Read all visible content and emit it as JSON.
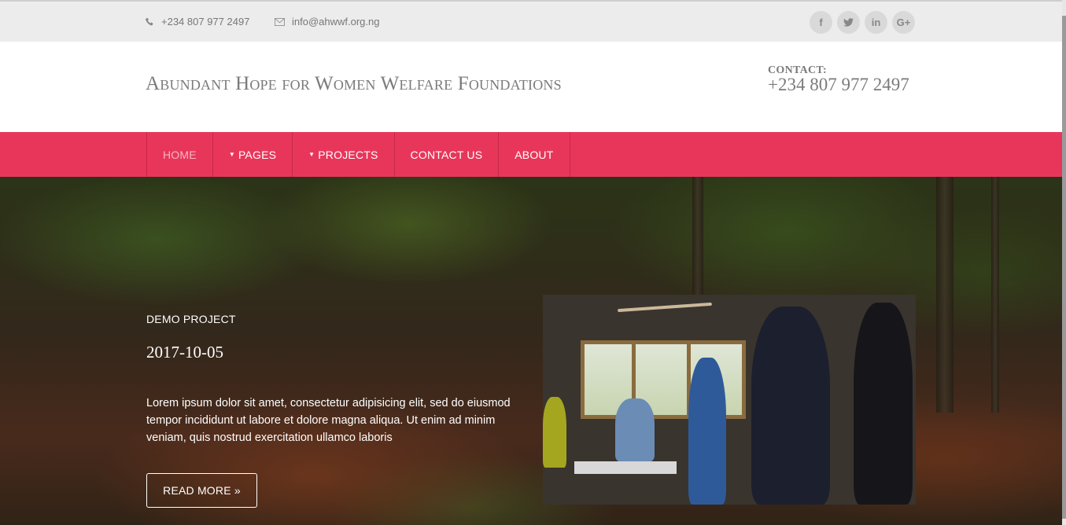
{
  "topbar": {
    "phone": "+234 807 977 2497",
    "email": "info@ahwwf.org.ng",
    "socials": [
      {
        "icon": "facebook-icon",
        "glyph": "f"
      },
      {
        "icon": "twitter-icon",
        "glyph": "t"
      },
      {
        "icon": "linkedin-icon",
        "glyph": "in"
      },
      {
        "icon": "google-plus-icon",
        "glyph": "G+"
      }
    ]
  },
  "header": {
    "title": "Abundant Hope for Women Welfare Foundations",
    "contact_label": "CONTACT:",
    "contact_number": "+234 807 977 2497"
  },
  "nav": {
    "items": [
      {
        "label": "HOME",
        "active": true
      },
      {
        "label": "PAGES",
        "dropdown": true
      },
      {
        "label": "PROJECTS",
        "dropdown": true
      },
      {
        "label": "CONTACT US"
      },
      {
        "label": "ABOUT"
      }
    ]
  },
  "hero": {
    "project_label": "DEMO PROJECT",
    "date": "2017-10-05",
    "description": "Lorem ipsum dolor sit amet, consectetur adipisicing elit, sed do eiusmod tempor incididunt ut labore et dolore magna aliqua. Ut enim ad minim veniam, quis nostrud exercitation ullamco laboris",
    "read_more": "READ MORE »"
  },
  "colors": {
    "nav_bg": "#e8365a",
    "topbar_bg": "#ececec",
    "title_text": "#7b7b7b"
  }
}
